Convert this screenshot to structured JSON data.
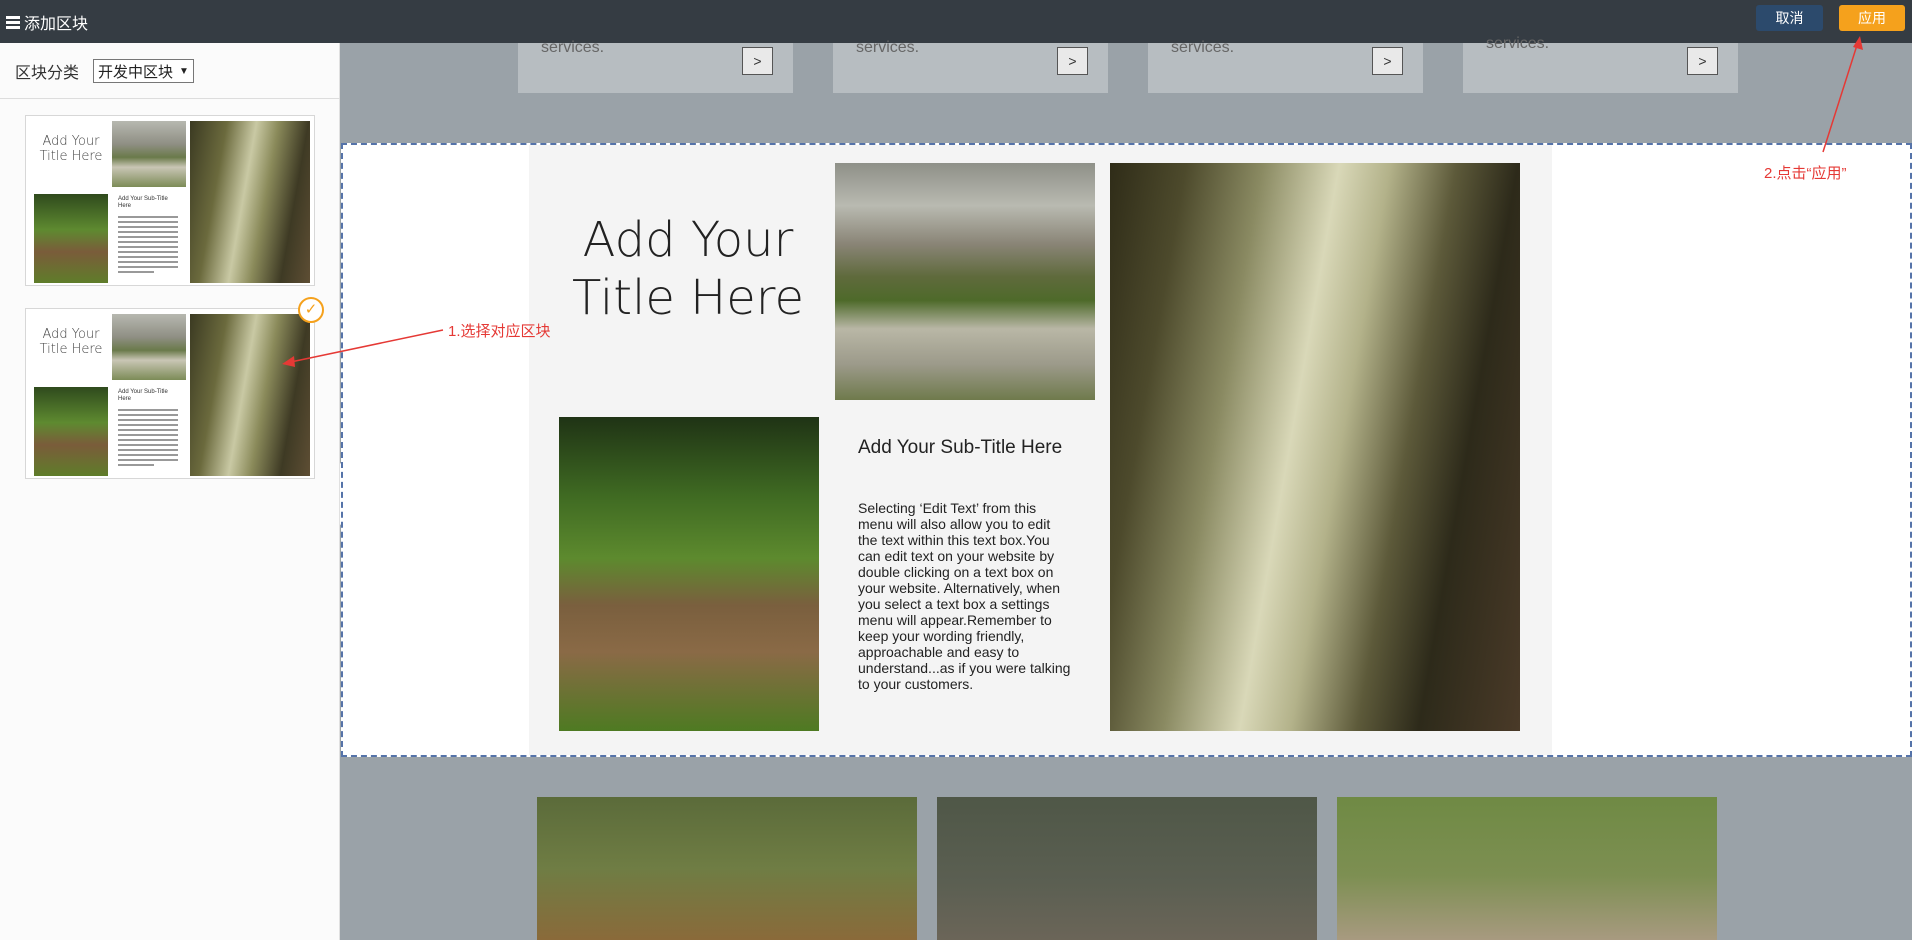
{
  "topbar": {
    "title": "添加区块",
    "cancel_label": "取消",
    "apply_label": "应用",
    "cancel_color": "#2c4a6c",
    "apply_color": "#f5a11c"
  },
  "sidebar": {
    "category_label": "区块分类",
    "category_value": "开发中区块",
    "thumbnails": [
      {
        "title": "Add Your Title Here",
        "subtitle": "Add Your Sub-Title Here",
        "selected": false
      },
      {
        "title": "Add Your Title Here",
        "subtitle": "Add Your Sub-Title Here",
        "selected": true
      }
    ],
    "collapse_icon": "chevron-left-icon"
  },
  "canvas": {
    "top_cards": [
      {
        "text": "services.",
        "arrow": ">"
      },
      {
        "text": "services.",
        "arrow": ">"
      },
      {
        "text": "services.",
        "arrow": ">"
      },
      {
        "text": "services.",
        "arrow": ">"
      }
    ],
    "block": {
      "title": "Add Your Title Here",
      "subtitle": "Add Your Sub-Title Here",
      "body": "Selecting ‘Edit Text’ from this menu will also allow you to edit the text within this text box.You can edit text on your website by double clicking on a text box on your website. Alternatively, when you select a text box a settings menu will appear.Remember to keep your wording friendly, approachable and easy to understand...as if you were talking to your customers."
    }
  },
  "annotations": {
    "step1": "1.选择对应区块",
    "step2": "2.点击“应用”",
    "color": "#e53935"
  }
}
